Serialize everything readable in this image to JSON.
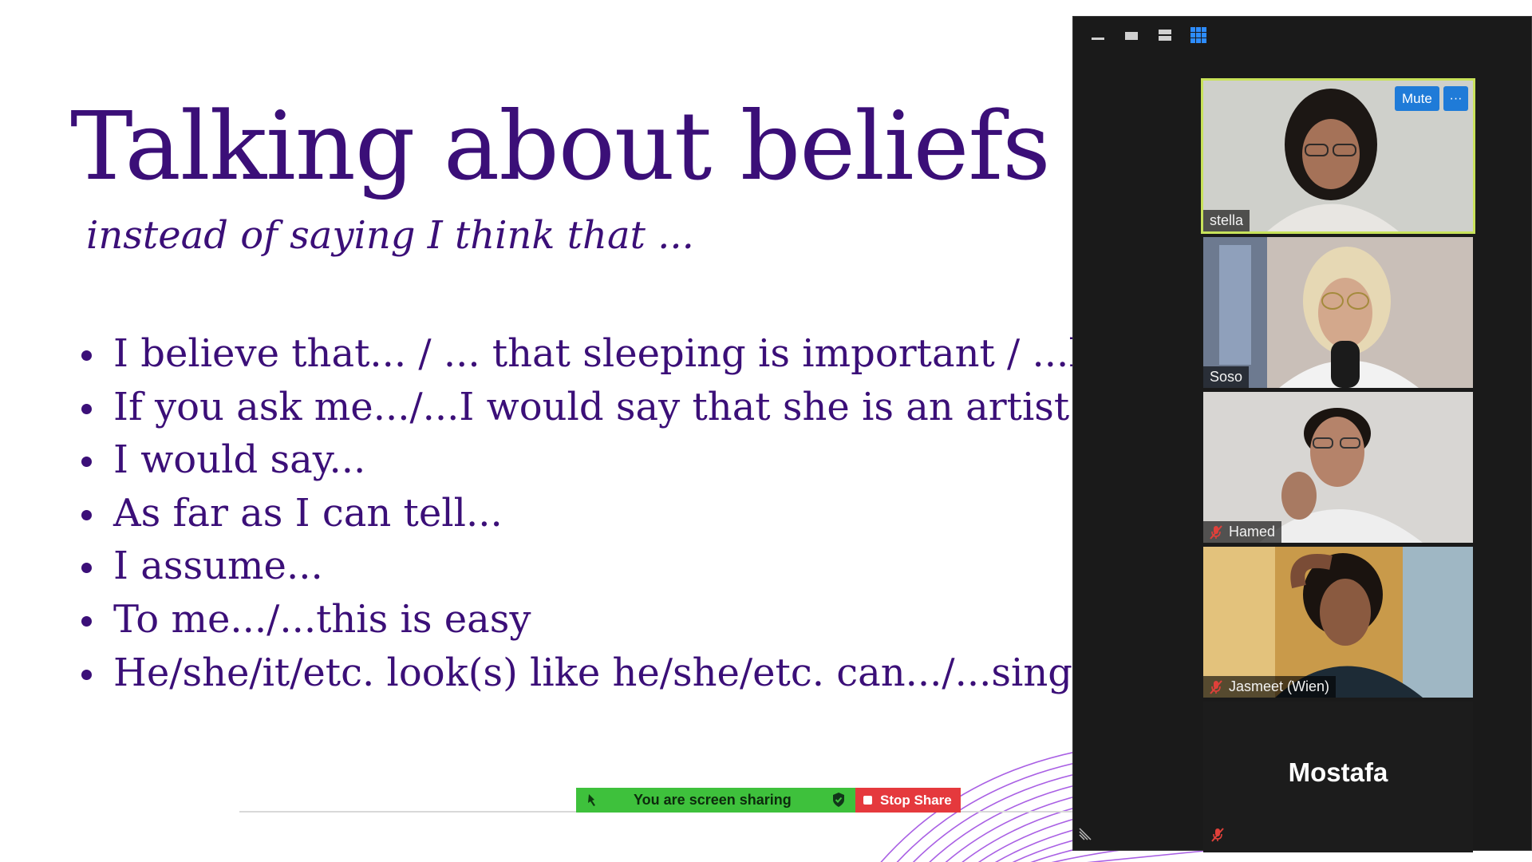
{
  "slide": {
    "title": "Talking about beliefs",
    "subtitle": "instead of saying I think that ...",
    "bullets": [
      "I believe that... / ... that sleeping is important / ...h",
      " If you ask me.../...I would say that she is an artist",
      "I would say...",
      "As far as I can tell...",
      "I assume...",
      "To me.../...this is easy",
      "He/she/it/etc. look(s) like he/she/etc. can.../...sing"
    ]
  },
  "share_bar": {
    "status_text": "You are screen sharing",
    "stop_label": "Stop Share"
  },
  "zoom": {
    "toolbar_icons": [
      "minimize-icon",
      "speaker-view-icon",
      "strip-view-icon",
      "gallery-view-icon"
    ],
    "participants": [
      {
        "name": "stella",
        "muted": false,
        "active_speaker": true
      },
      {
        "name": "Soso",
        "muted": false
      },
      {
        "name": "Hamed",
        "muted": true
      },
      {
        "name": "Jasmeet (Wien)",
        "muted": true
      },
      {
        "name": "Mostafa",
        "muted": true,
        "video": false
      }
    ],
    "mute_label": "Mute",
    "more_label": "···"
  },
  "colors": {
    "slide_text": "#3b0f78",
    "panel_bg": "#1a1a1a",
    "share_green": "#3ec13c",
    "stop_red": "#e5393d",
    "zoom_blue": "#1f7bd8",
    "active_outline": "#c8e25a"
  }
}
